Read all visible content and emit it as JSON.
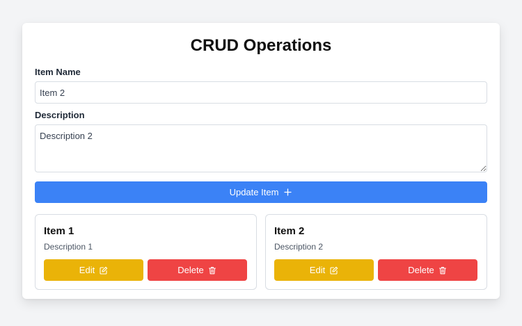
{
  "app": {
    "title": "CRUD Operations"
  },
  "form": {
    "name_label": "Item Name",
    "name_value": "Item 2",
    "description_label": "Description",
    "description_value": "Description 2",
    "submit_label": "Update Item",
    "submit_icon": "plus-icon"
  },
  "items": [
    {
      "title": "Item 1",
      "description": "Description 1",
      "edit_label": "Edit",
      "edit_icon": "pencil-square-icon",
      "delete_label": "Delete",
      "delete_icon": "trash-icon"
    },
    {
      "title": "Item 2",
      "description": "Description 2",
      "edit_label": "Edit",
      "edit_icon": "pencil-square-icon",
      "delete_label": "Delete",
      "delete_icon": "trash-icon"
    }
  ],
  "colors": {
    "background": "#f3f4f6",
    "primary": "#3b82f6",
    "edit": "#eab308",
    "delete": "#ef4444"
  }
}
